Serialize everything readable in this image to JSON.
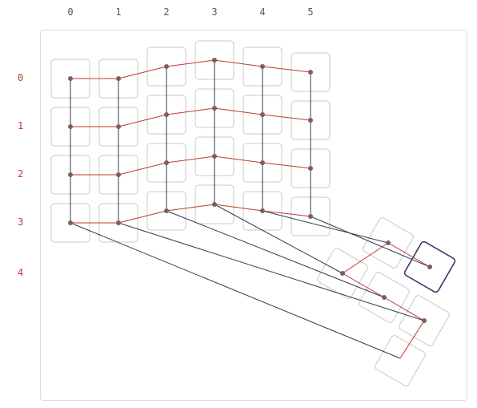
{
  "columns": [
    {
      "label": "0"
    },
    {
      "label": "1"
    },
    {
      "label": "2"
    },
    {
      "label": "3"
    },
    {
      "label": "4"
    },
    {
      "label": "5"
    }
  ],
  "rows": [
    {
      "label": "0"
    },
    {
      "label": "1"
    },
    {
      "label": "2"
    },
    {
      "label": "3"
    },
    {
      "label": "4"
    }
  ],
  "colors": {
    "row_edge": "#c0392b",
    "column_edge": "#2c3e50",
    "node": "#7a6060",
    "cell_border": "#c8c8c8",
    "selected_cell_border": "#3a3a6a"
  },
  "grid": {
    "columns": 6,
    "rows": 4,
    "tail_row_cells": 5,
    "selected_tail_cell": 4
  }
}
